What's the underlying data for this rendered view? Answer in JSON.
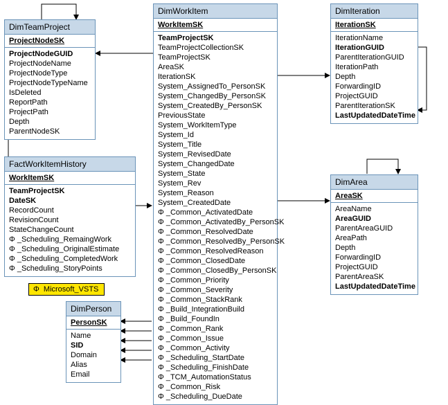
{
  "legend": {
    "phi": "Φ",
    "text": "Microsoft_VSTS"
  },
  "phiGlyph": "Φ",
  "tables": {
    "dimTeamProject": {
      "title": "DimTeamProject",
      "pk": "ProjectNodeSK",
      "fields": [
        {
          "t": "ProjectNodeGUID",
          "b": true
        },
        {
          "t": "ProjectNodeName"
        },
        {
          "t": "ProjectNodeType"
        },
        {
          "t": "ProjectNodeTypeName"
        },
        {
          "t": "IsDeleted"
        },
        {
          "t": "ReportPath"
        },
        {
          "t": "ProjectPath"
        },
        {
          "t": "Depth"
        },
        {
          "t": "ParentNodeSK"
        }
      ]
    },
    "factWorkItemHistory": {
      "title": "FactWorkItemHistory",
      "pk": "WorkItemSK",
      "fields": [
        {
          "t": "TeamProjectSK",
          "b": true
        },
        {
          "t": "DateSK",
          "b": true
        },
        {
          "t": "RecordCount"
        },
        {
          "t": "RevisionCount"
        },
        {
          "t": "StateChangeCount"
        },
        {
          "t": "_Scheduling_RemaingWork",
          "phi": true
        },
        {
          "t": "_Scheduling_OriginalEstimate",
          "phi": true
        },
        {
          "t": "_Scheduling_CompletedWork",
          "phi": true
        },
        {
          "t": "_Scheduling_StoryPoints",
          "phi": true
        }
      ]
    },
    "dimPerson": {
      "title": "DimPerson",
      "pk": "PersonSK",
      "fields": [
        {
          "t": "Name"
        },
        {
          "t": "SID",
          "b": true
        },
        {
          "t": "Domain"
        },
        {
          "t": "Alias"
        },
        {
          "t": "Email"
        }
      ]
    },
    "dimWorkItem": {
      "title": "DimWorkItem",
      "pk": "WorkItemSK",
      "fields": [
        {
          "t": "TeamProjectSK",
          "b": true
        },
        {
          "t": "TeamProjectCollectionSK"
        },
        {
          "t": "TeamProjectSK"
        },
        {
          "t": "AreaSK"
        },
        {
          "t": "IterationSK"
        },
        {
          "t": "System_AssignedTo_PersonSK"
        },
        {
          "t": "System_ChangedBy_PersonSK"
        },
        {
          "t": "System_CreatedBy_PersonSK"
        },
        {
          "t": "PreviousState"
        },
        {
          "t": "System_WorkItemType"
        },
        {
          "t": "System_Id"
        },
        {
          "t": "System_Title"
        },
        {
          "t": "System_RevisedDate"
        },
        {
          "t": "System_ChangedDate"
        },
        {
          "t": "System_State"
        },
        {
          "t": "System_Rev"
        },
        {
          "t": "System_Reason"
        },
        {
          "t": "System_CreatedDate"
        },
        {
          "t": "_Common_ActivatedDate",
          "phi": true
        },
        {
          "t": "_Common_ActivatedBy_PersonSK",
          "phi": true
        },
        {
          "t": "_Common_ResolvedDate",
          "phi": true
        },
        {
          "t": "_Common_ResolvedBy_PersonSK",
          "phi": true
        },
        {
          "t": "_Common_ResolvedReason",
          "phi": true
        },
        {
          "t": "_Common_ClosedDate",
          "phi": true
        },
        {
          "t": "_Common_ClosedBy_PersonSK",
          "phi": true
        },
        {
          "t": "_Common_Priority",
          "phi": true
        },
        {
          "t": "_Common_Severity",
          "phi": true
        },
        {
          "t": "_Common_StackRank",
          "phi": true
        },
        {
          "t": "_Build_IntegrationBuild",
          "phi": true
        },
        {
          "t": "_Build_FoundIn",
          "phi": true
        },
        {
          "t": "_Common_Rank",
          "phi": true
        },
        {
          "t": "_Common_Issue",
          "phi": true
        },
        {
          "t": "_Common_Activity",
          "phi": true
        },
        {
          "t": "_Scheduling_StartDate",
          "phi": true
        },
        {
          "t": "_Scheduling_FinishDate",
          "phi": true
        },
        {
          "t": "_TCM_AutomationStatus",
          "phi": true
        },
        {
          "t": "_Common_Risk",
          "phi": true
        },
        {
          "t": "_Scheduling_DueDate",
          "phi": true
        }
      ]
    },
    "dimIteration": {
      "title": "DimIteration",
      "pk": "IterationSK",
      "fields": [
        {
          "t": "IterationName"
        },
        {
          "t": "IterationGUID",
          "b": true
        },
        {
          "t": "ParentIterationGUID"
        },
        {
          "t": "IterationPath"
        },
        {
          "t": "Depth"
        },
        {
          "t": "ForwardingID"
        },
        {
          "t": "ProjectGUID"
        },
        {
          "t": "ParentIterationSK"
        },
        {
          "t": "LastUpdatedDateTime",
          "b": true
        }
      ]
    },
    "dimArea": {
      "title": "DimArea",
      "pk": "AreaSK",
      "fields": [
        {
          "t": "AreaName"
        },
        {
          "t": "AreaGUID",
          "b": true
        },
        {
          "t": "ParentAreaGUID"
        },
        {
          "t": "AreaPath"
        },
        {
          "t": "Depth"
        },
        {
          "t": "ForwardingID"
        },
        {
          "t": "ProjectGUID"
        },
        {
          "t": "ParentAreaSK"
        },
        {
          "t": "LastUpdatedDateTime",
          "b": true
        }
      ]
    }
  }
}
